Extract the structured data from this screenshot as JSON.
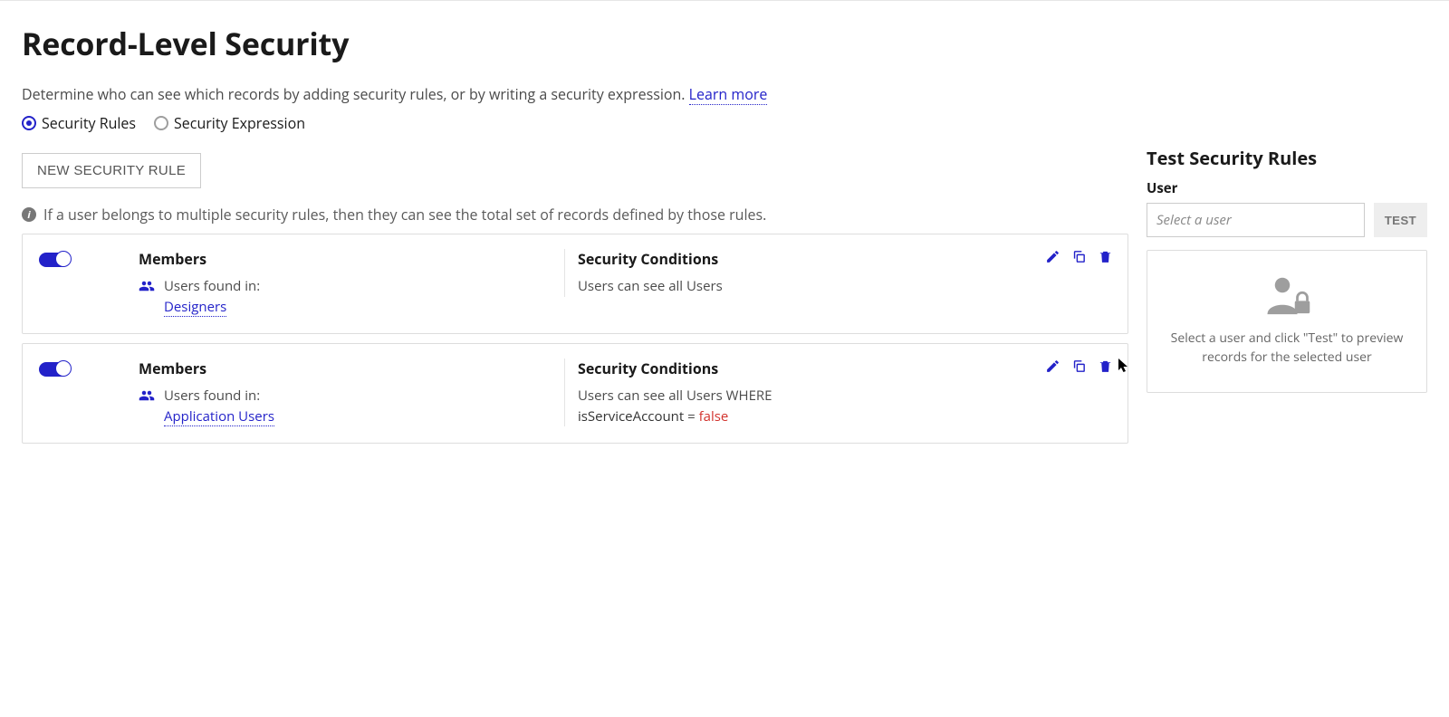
{
  "header": {
    "title": "Record-Level Security",
    "description_prefix": "Determine who can see which records by adding security rules, or by writing a security expression. ",
    "learn_more": "Learn more"
  },
  "mode": {
    "rules_label": "Security Rules",
    "expression_label": "Security Expression"
  },
  "new_rule_label": "NEW SECURITY RULE",
  "info_text": "If a user belongs to multiple security rules, then they can see the total set of records defined by those rules.",
  "rules": [
    {
      "members_title": "Members",
      "users_found_in": "Users found in:",
      "group_link": "Designers",
      "conditions_title": "Security Conditions",
      "condition_line1": "Users can see all Users"
    },
    {
      "members_title": "Members",
      "users_found_in": "Users found in:",
      "group_link": "Application Users",
      "conditions_title": "Security Conditions",
      "condition_line1": "Users can see all Users WHERE",
      "condition_expr_field": "isServiceAccount",
      "condition_expr_eq": " = ",
      "condition_expr_value": "false"
    }
  ],
  "test_panel": {
    "title": "Test Security Rules",
    "user_label": "User",
    "placeholder": "Select a user",
    "test_button": "TEST",
    "empty_text": "Select a user and click \"Test\" to preview records for the selected user"
  }
}
